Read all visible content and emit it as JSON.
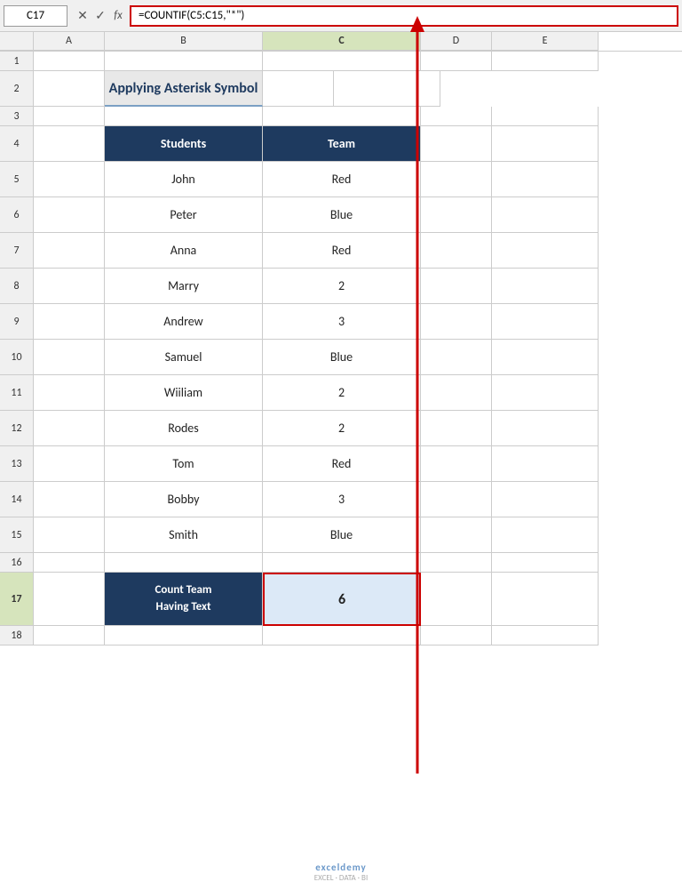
{
  "cell_ref": "C17",
  "formula": "=COUNTIF(C5:C15,\"*\")",
  "fx_label": "fx",
  "title": "Applying Asterisk Symbol",
  "col_headers": [
    "A",
    "B",
    "C",
    "D",
    "E"
  ],
  "students_header": "Students",
  "team_header": "Team",
  "rows": [
    {
      "student": "John",
      "team": "Red"
    },
    {
      "student": "Peter",
      "team": "Blue"
    },
    {
      "student": "Anna",
      "team": "Red"
    },
    {
      "student": "Marry",
      "team": "2"
    },
    {
      "student": "Andrew",
      "team": "3"
    },
    {
      "student": "Samuel",
      "team": "Blue"
    },
    {
      "student": "Wiiliam",
      "team": "2"
    },
    {
      "student": "Rodes",
      "team": "2"
    },
    {
      "student": "Tom",
      "team": "Red"
    },
    {
      "student": "Bobby",
      "team": "3"
    },
    {
      "student": "Smith",
      "team": "Blue"
    }
  ],
  "result_label": "Count Team\nHaving Text",
  "result_value": "6",
  "watermark_name": "exceldemy",
  "watermark_sub": "EXCEL · DATA · BI",
  "top_icons": [
    "×",
    "✓"
  ],
  "row_numbers": [
    "1",
    "2",
    "3",
    "4",
    "5",
    "6",
    "7",
    "8",
    "9",
    "10",
    "11",
    "12",
    "13",
    "14",
    "15",
    "16",
    "17",
    "18"
  ]
}
